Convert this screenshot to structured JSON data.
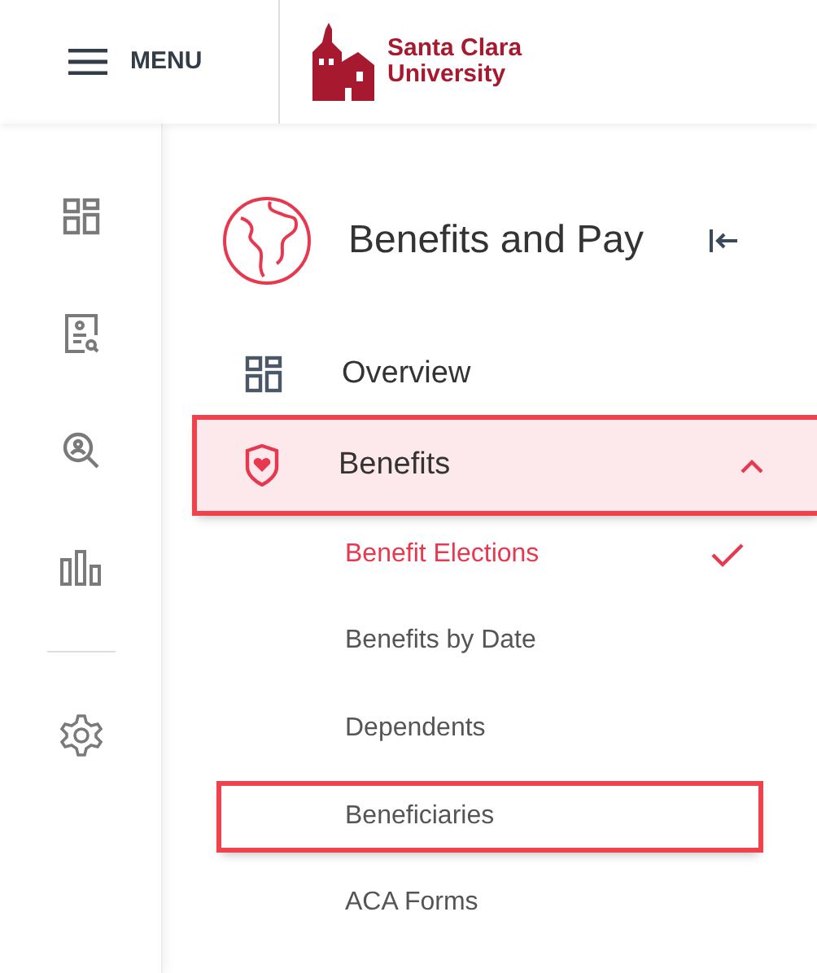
{
  "header": {
    "menu_label": "MENU",
    "logo_line_1": "Santa Clara",
    "logo_line_2": "University"
  },
  "rail": [
    {
      "kind": "dashboard"
    },
    {
      "kind": "profile"
    },
    {
      "kind": "search"
    },
    {
      "kind": "chart"
    },
    {
      "kind": "divider"
    },
    {
      "kind": "settings"
    }
  ],
  "panel": {
    "title": "Benefits and Pay",
    "items": [
      {
        "label": "Overview",
        "kind": "dashboard",
        "selected": false,
        "highlighted": false
      },
      {
        "label": "Benefits",
        "kind": "benefits",
        "selected": true,
        "highlighted": true,
        "expanded": true,
        "children": [
          {
            "label": "Benefit Elections",
            "selected": true,
            "highlighted": false
          },
          {
            "label": "Benefits by Date",
            "selected": false,
            "highlighted": false
          },
          {
            "label": "Dependents",
            "selected": false,
            "highlighted": false
          },
          {
            "label": "Beneficiaries",
            "selected": false,
            "highlighted": true
          },
          {
            "label": "ACA Forms",
            "selected": false,
            "highlighted": false
          }
        ]
      }
    ]
  }
}
